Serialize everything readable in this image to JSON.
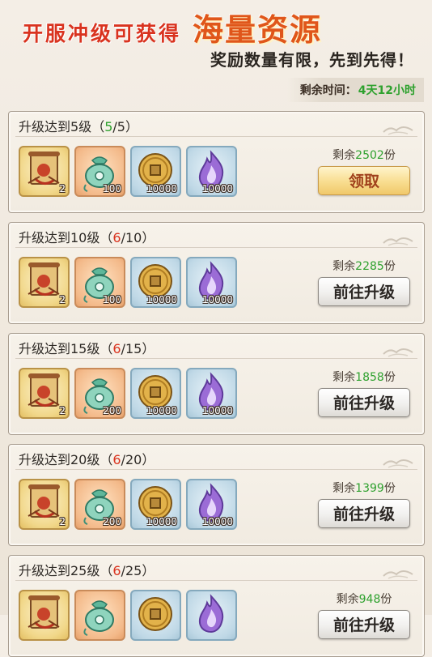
{
  "header": {
    "title_small": "开服冲级可获得",
    "title_big": "海量资源",
    "subtitle": "奖励数量有限，先到先得！",
    "timer_label": "剩余时间：",
    "timer_value": "4天12小时"
  },
  "colors": {
    "accent_red": "#d9331f",
    "accent_orange": "#e0561a",
    "done_green": "#2ea12e"
  },
  "cards": [
    {
      "title": "升级达到5级",
      "open": "（",
      "progress_current": "5",
      "progress_rest": "/5）",
      "status": "done",
      "remain_label": "剩余",
      "remain_value": "2502",
      "remain_unit": "份",
      "button_label": "领取",
      "button_type": "claim",
      "items": [
        {
          "icon": "scroll-icon",
          "qty": "2"
        },
        {
          "icon": "jade-pouch-icon",
          "qty": "100"
        },
        {
          "icon": "copper-coin-icon",
          "qty": "10000"
        },
        {
          "icon": "purple-flame-icon",
          "qty": "10000"
        }
      ]
    },
    {
      "title": "升级达到10级",
      "open": "（",
      "progress_current": "6",
      "progress_rest": "/10）",
      "status": "todo",
      "remain_label": "剩余",
      "remain_value": "2285",
      "remain_unit": "份",
      "button_label": "前往升级",
      "button_type": "go",
      "items": [
        {
          "icon": "scroll-icon",
          "qty": "2"
        },
        {
          "icon": "jade-pouch-icon",
          "qty": "100"
        },
        {
          "icon": "copper-coin-icon",
          "qty": "10000"
        },
        {
          "icon": "purple-flame-icon",
          "qty": "10000"
        }
      ]
    },
    {
      "title": "升级达到15级",
      "open": "（",
      "progress_current": "6",
      "progress_rest": "/15）",
      "status": "todo",
      "remain_label": "剩余",
      "remain_value": "1858",
      "remain_unit": "份",
      "button_label": "前往升级",
      "button_type": "go",
      "items": [
        {
          "icon": "scroll-icon",
          "qty": "2"
        },
        {
          "icon": "jade-pouch-icon",
          "qty": "200"
        },
        {
          "icon": "copper-coin-icon",
          "qty": "10000"
        },
        {
          "icon": "purple-flame-icon",
          "qty": "10000"
        }
      ]
    },
    {
      "title": "升级达到20级",
      "open": "（",
      "progress_current": "6",
      "progress_rest": "/20）",
      "status": "todo",
      "remain_label": "剩余",
      "remain_value": "1399",
      "remain_unit": "份",
      "button_label": "前往升级",
      "button_type": "go",
      "items": [
        {
          "icon": "scroll-icon",
          "qty": "2"
        },
        {
          "icon": "jade-pouch-icon",
          "qty": "200"
        },
        {
          "icon": "copper-coin-icon",
          "qty": "10000"
        },
        {
          "icon": "purple-flame-icon",
          "qty": "10000"
        }
      ]
    },
    {
      "title": "升级达到25级",
      "open": "（",
      "progress_current": "6",
      "progress_rest": "/25）",
      "status": "todo",
      "remain_label": "剩余",
      "remain_value": "948",
      "remain_unit": "份",
      "button_label": "前往升级",
      "button_type": "go",
      "items": [
        {
          "icon": "scroll-icon",
          "qty": ""
        },
        {
          "icon": "jade-pouch-icon",
          "qty": ""
        },
        {
          "icon": "copper-coin-icon",
          "qty": ""
        },
        {
          "icon": "purple-flame-icon",
          "qty": ""
        }
      ]
    }
  ]
}
